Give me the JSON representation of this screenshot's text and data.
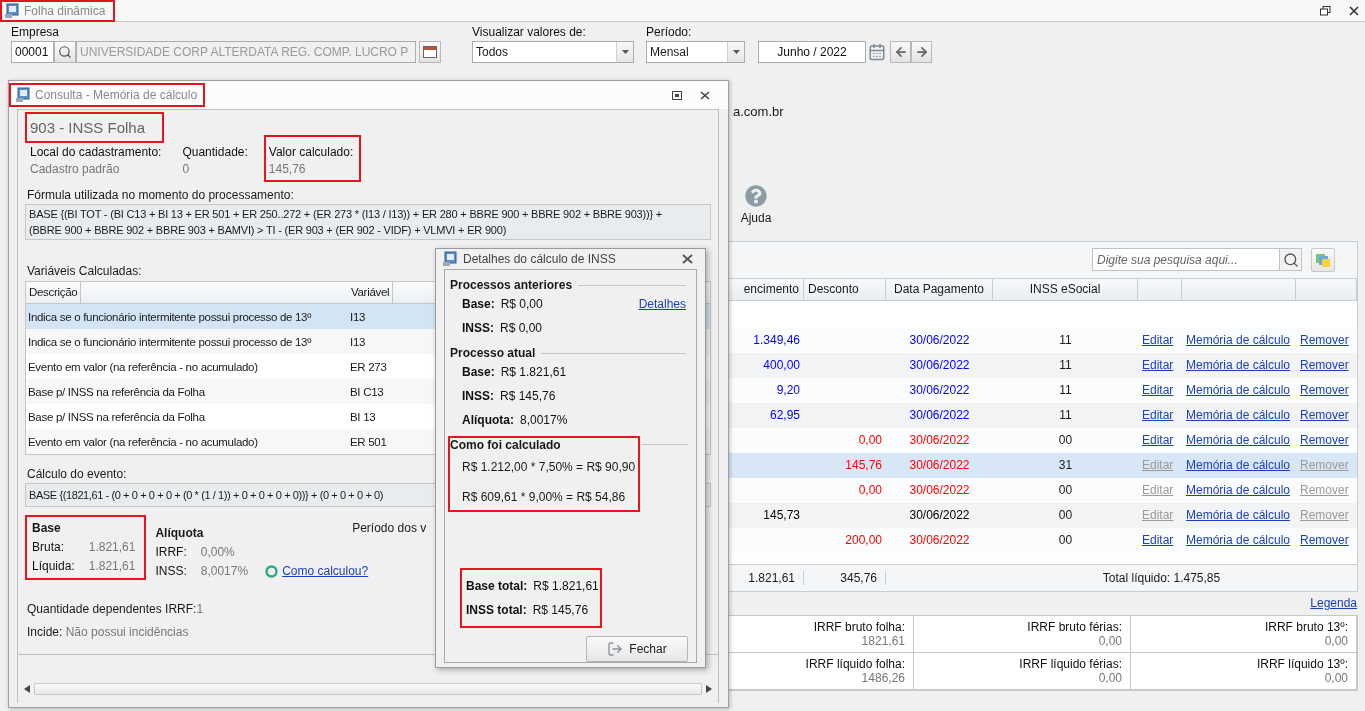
{
  "window": {
    "title": "Folha dinâmica",
    "highlighted": true
  },
  "filters": {
    "company": {
      "label": "Empresa",
      "code": "00001",
      "name": "UNIVERSIDADE CORP ALTERDATA REG. COMP. LUCRO P"
    },
    "view": {
      "label": "Visualizar valores de:",
      "value": "Todos"
    },
    "period": {
      "label": "Período:",
      "value": "Mensal"
    },
    "month": {
      "value": "Junho / 2022"
    }
  },
  "background": {
    "email_fragment": "a.com.br",
    "help_button": "Ajuda"
  },
  "grid": {
    "search": {
      "placeholder": "Digite sua pesquisa aqui..."
    },
    "columns": [
      "encimento",
      "Desconto",
      "Data Pagamento",
      "INSS eSocial"
    ],
    "rows": [
      {
        "vencimento": "1.349,46",
        "date": "30/06/2022",
        "inss": "11",
        "color": "#0000ff",
        "selected": false,
        "disabled": false,
        "actions": [
          "Editar",
          "Memória de cálculo",
          "Remover"
        ]
      },
      {
        "vencimento": "400,00",
        "date": "30/06/2022",
        "inss": "11",
        "color": "#0000ff",
        "selected": false,
        "disabled": false,
        "actions": [
          "Editar",
          "Memória de cálculo",
          "Remover"
        ]
      },
      {
        "vencimento": "9,20",
        "date": "30/06/2022",
        "inss": "11",
        "color": "#0000ff",
        "selected": false,
        "disabled": false,
        "actions": [
          "Editar",
          "Memória de cálculo",
          "Remover"
        ]
      },
      {
        "vencimento": "62,95",
        "date": "30/06/2022",
        "inss": "11",
        "color": "#0000ff",
        "selected": false,
        "disabled": false,
        "actions": [
          "Editar",
          "Memória de cálculo",
          "Remover"
        ]
      },
      {
        "desconto": "0,00",
        "date": "30/06/2022",
        "inss": "00",
        "color": "#ff0000",
        "selected": false,
        "disabled": false,
        "actions": [
          "Editar",
          "Memória de cálculo",
          "Remover"
        ]
      },
      {
        "desconto": "145,76",
        "date": "30/06/2022",
        "inss": "31",
        "color": "#ff0000",
        "selected": true,
        "disabled": true,
        "actions": [
          "Editar",
          "Memória de cálculo",
          "Remover"
        ]
      },
      {
        "desconto": "0,00",
        "date": "30/06/2022",
        "inss": "00",
        "color": "#ff0000",
        "selected": false,
        "disabled": true,
        "actions": [
          "Editar",
          "Memória de cálculo",
          "Remover"
        ]
      },
      {
        "vencimento": "145,73",
        "date": "30/06/2022",
        "inss": "00",
        "color": "#000000",
        "selected": false,
        "disabled": true,
        "actions": [
          "Editar",
          "Memória de cálculo",
          "Remover"
        ]
      },
      {
        "desconto": "200,00",
        "date": "30/06/2022",
        "inss": "00",
        "color": "#ff0000",
        "selected": false,
        "disabled": false,
        "actions": [
          "Editar",
          "Memória de cálculo",
          "Remover"
        ]
      }
    ],
    "totals": [
      "1.821,61",
      "345,76"
    ],
    "net_total": "Total líquido: 1.475,85"
  },
  "legend_link": "Legenda",
  "irrf": [
    {
      "label": "IRRF bruto folha:",
      "value": "1821,61"
    },
    {
      "label": "IRRF bruto férias:",
      "value": "0,00"
    },
    {
      "label": "IRRF bruto 13º:",
      "value": "0,00"
    },
    {
      "label": "IRRF líquido folha:",
      "value": "1486,26"
    },
    {
      "label": "IRRF líquido férias:",
      "value": "0,00"
    },
    {
      "label": "IRRF líquido 13º:",
      "value": "0,00"
    }
  ],
  "memory_dialog": {
    "title": "Consulta - Memória de cálculo",
    "highlighted": true,
    "heading": {
      "text": "903 - INSS Folha",
      "highlighted": true
    },
    "fields": [
      {
        "label": "Local do cadastramento:",
        "value": "Cadastro padrão",
        "highlighted": false
      },
      {
        "label": "Quantidade:",
        "value": "0",
        "highlighted": false
      },
      {
        "label": "Valor calculado:",
        "value": "145,76",
        "highlighted": true
      }
    ],
    "formula": {
      "label": "Fórmula utilizada no momento do processamento:",
      "lines": [
        "BASE {(BI TOT - (BI C13 + BI 13 + ER 501 + ER 250..272 + (ER 273 * (I13 / I13)) + ER 280 + BBRE 900 + BBRE 902 + BBRE 903))} +",
        "(BBRE 900 + BBRE 902 + BBRE 903 + BAMVI) > TI - (ER 903 + (ER 902 - VIDF) + VLMVI + ER 900)"
      ]
    },
    "variables": {
      "label": "Variáveis Calculadas:",
      "columns": [
        "Descrição",
        "Variável"
      ],
      "rows": [
        {
          "description": "Indica se o funcionário intermitente possui processo de 13º",
          "variable": "I13",
          "selected": true
        },
        {
          "description": "Indica se o funcionário intermitente possui processo de 13º",
          "variable": "I13",
          "selected": false
        },
        {
          "description": "Evento em valor (na referência - no acumulado)",
          "variable": "ER 273",
          "selected": false
        },
        {
          "description": "Base p/ INSS na referência da Folha",
          "variable": "BI C13",
          "selected": false
        },
        {
          "description": "Base p/ INSS na referência da Folha",
          "variable": "BI 13",
          "selected": false
        },
        {
          "description": "Evento em valor (na referência - no acumulado)",
          "variable": "ER 501",
          "selected": false
        }
      ]
    },
    "calculation": {
      "label": "Cálculo do evento:",
      "text": "BASE {(1821,61 - (0 + 0 + 0 + 0 + (0 * (1 / 1)) + 0 + 0 + 0 + 0))} + (0 + 0 + 0 + 0)"
    },
    "base": {
      "title": "Base",
      "highlighted": true,
      "items": [
        {
          "label": "Bruta:",
          "value": "1.821,61"
        },
        {
          "label": "Líquida:",
          "value": "1.821,61"
        }
      ]
    },
    "rate": {
      "title": "Alíquota",
      "items": [
        {
          "label": "IRRF:",
          "value": "0,00%"
        },
        {
          "label": "INSS:",
          "value": "8,0017%"
        }
      ],
      "link": "Como calculou?"
    },
    "period_label": "Período dos v",
    "dependents": {
      "label": "Quantidade dependentes IRRF:",
      "value": "1"
    },
    "incidence": {
      "label": "Incide:",
      "value": "Não possui incidências"
    }
  },
  "inss_dialog": {
    "title": "Detalhes do cálculo de INSS",
    "sections": [
      {
        "kind": "values",
        "title": "Processos anteriores",
        "highlighted": false,
        "link": "Detalhes",
        "items": [
          {
            "label": "Base:",
            "value": "R$ 0,00"
          },
          {
            "label": "INSS:",
            "value": "R$ 0,00"
          }
        ]
      },
      {
        "kind": "values",
        "title": "Processo atual",
        "highlighted": false,
        "items": [
          {
            "label": "Base:",
            "value": "R$ 1.821,61"
          },
          {
            "label": "INSS:",
            "value": "R$ 145,76"
          },
          {
            "label": "Alíquota:",
            "value": "8,0017%"
          }
        ]
      },
      {
        "kind": "lines",
        "title": "Como foi calculado",
        "highlighted": true,
        "lines": [
          "R$ 1.212,00 * 7,50% = R$ 90,90",
          "R$ 609,61 * 9,00% = R$ 54,86"
        ]
      }
    ],
    "totals": {
      "highlighted": true,
      "items": [
        {
          "label": "Base total:",
          "value": "R$ 1.821,61"
        },
        {
          "label": "INSS total:",
          "value": "R$ 145,76"
        }
      ]
    },
    "close_button": "Fechar"
  }
}
